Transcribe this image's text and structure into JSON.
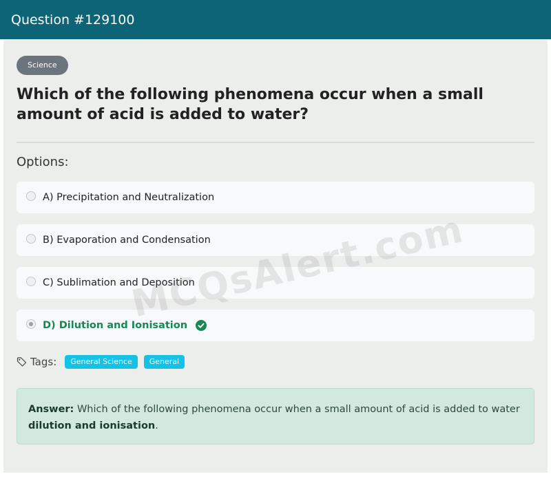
{
  "header": {
    "title": "Question #129100"
  },
  "category_badge": "Science",
  "question": {
    "text": "Which of the following phenomena occur when a small amount of acid is added to water?"
  },
  "options_heading": "Options:",
  "options": [
    {
      "label": "A) Precipitation and Neutralization",
      "selected": false,
      "correct": false
    },
    {
      "label": "B) Evaporation and Condensation",
      "selected": false,
      "correct": false
    },
    {
      "label": "C) Sublimation and Deposition",
      "selected": false,
      "correct": false
    },
    {
      "label": "D) Dilution and Ionisation",
      "selected": true,
      "correct": true
    }
  ],
  "tags": {
    "label": "Tags:",
    "items": [
      "General Science",
      "General"
    ]
  },
  "answer": {
    "prefix": "Answer:",
    "text": "Which of the following phenomena occur when a small amount of acid is added to water",
    "value": "dilution and ionisation",
    "suffix": "."
  },
  "watermark": "MCQsAlert.com",
  "colors": {
    "header_bg": "#0c6476",
    "badge_bg": "#6c757d",
    "correct_green": "#198754",
    "tag_bg": "#16c1e6",
    "answer_bg": "#d2e9de"
  },
  "icons": {
    "correct": "check-circle-icon",
    "tags": "tag-icon",
    "radio": "radio-icon"
  }
}
